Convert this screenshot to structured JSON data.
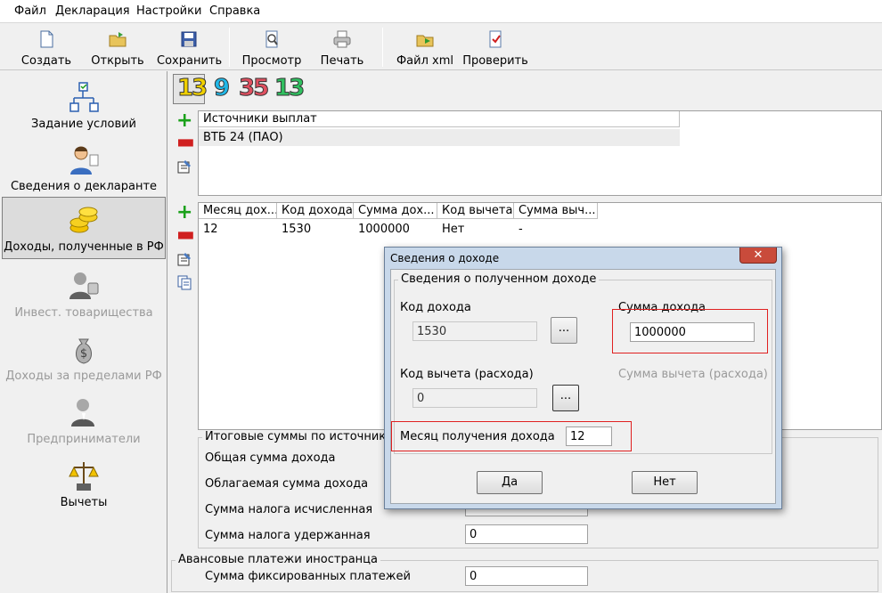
{
  "menu": {
    "file": "Файл",
    "declaration": "Декларация",
    "settings": "Настройки",
    "help": "Справка"
  },
  "toolbar": {
    "create": "Создать",
    "open": "Открыть",
    "save": "Сохранить",
    "preview": "Просмотр",
    "print": "Печать",
    "xml": "Файл xml",
    "check": "Проверить"
  },
  "sidebar": {
    "items": [
      {
        "label": "Задание условий",
        "icon": "conditions-tree-icon"
      },
      {
        "label": "Сведения о декларанте",
        "icon": "declarant-person-icon"
      },
      {
        "label": "Доходы, полученные в РФ",
        "icon": "coins-icon"
      },
      {
        "label": "Инвест. товарищества",
        "icon": "investment-icon"
      },
      {
        "label": "Доходы за пределами РФ",
        "icon": "money-bag-icon"
      },
      {
        "label": "Предприниматели",
        "icon": "entrepreneur-icon"
      },
      {
        "label": "Вычеты",
        "icon": "deductions-scales-icon"
      }
    ]
  },
  "rate_tabs": {
    "t13": "13",
    "t9": "9",
    "t35": "35",
    "t13b": "13"
  },
  "sources": {
    "header": "Источники выплат",
    "rows": [
      "ВТБ 24 (ПАО)"
    ]
  },
  "income_table": {
    "columns": [
      "Месяц дох...",
      "Код дохода",
      "Сумма дох...",
      "Код вычета",
      "Сумма выч..."
    ],
    "rows": [
      [
        "12",
        "1530",
        "1000000",
        "Нет",
        "-"
      ]
    ]
  },
  "totals": {
    "title": "Итоговые суммы по источнику",
    "total_income": "Общая сумма дохода",
    "taxable_income": "Облагаемая сумма дохода",
    "tax_calculated": "Сумма налога исчисленная",
    "tax_withheld": "Сумма налога удержанная",
    "tax_withheld_value": "0"
  },
  "advance": {
    "title": "Авансовые платежи иностранца",
    "fixed_payments": "Сумма фиксированных платежей",
    "fixed_payments_value": "0"
  },
  "dialog": {
    "title": "Сведения о доходе",
    "close": "✕",
    "group": "Сведения о полученном доходе",
    "income_code_label": "Код дохода",
    "income_code_value": "1530",
    "browse": "...",
    "income_sum_label": "Сумма дохода",
    "income_sum_value": "1000000",
    "deduction_code_label": "Код вычета (расхода)",
    "deduction_code_value": "0",
    "deduction_sum_label": "Сумма вычета (расхода)",
    "month_label": "Месяц получения дохода",
    "month_value": "12",
    "yes": "Да",
    "no": "Нет"
  }
}
